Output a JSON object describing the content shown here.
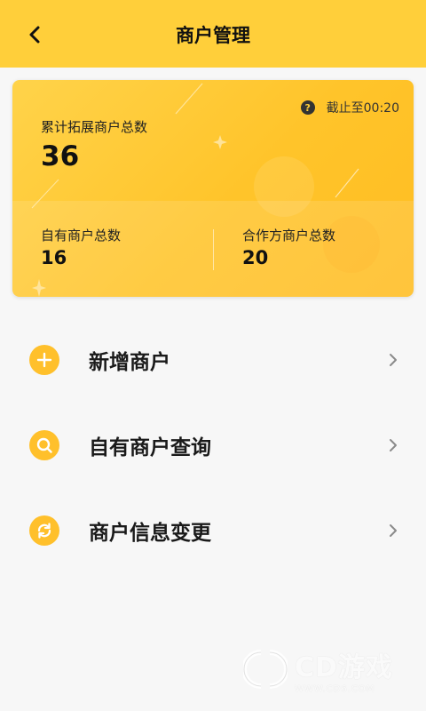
{
  "header": {
    "title": "商户管理",
    "back_icon": "chevron-left-icon"
  },
  "stats": {
    "total_label": "累计拓展商户总数",
    "total_value": "36",
    "cutoff_text": "截止至00:20",
    "help_icon_text": "?",
    "own_label": "自有商户总数",
    "own_value": "16",
    "partner_label": "合作方商户总数",
    "partner_value": "20"
  },
  "menu": {
    "items": [
      {
        "label": "新增商户",
        "icon": "plus-icon"
      },
      {
        "label": "自有商户查询",
        "icon": "search-icon"
      },
      {
        "label": "商户信息变更",
        "icon": "refresh-icon"
      }
    ]
  },
  "watermark": {
    "brand": "CD游戏",
    "url": "WWW.CD6.COM"
  },
  "colors": {
    "header_bg": "#ffcf3a",
    "accent": "#ffc02b",
    "page_bg": "#f7f7f7"
  }
}
